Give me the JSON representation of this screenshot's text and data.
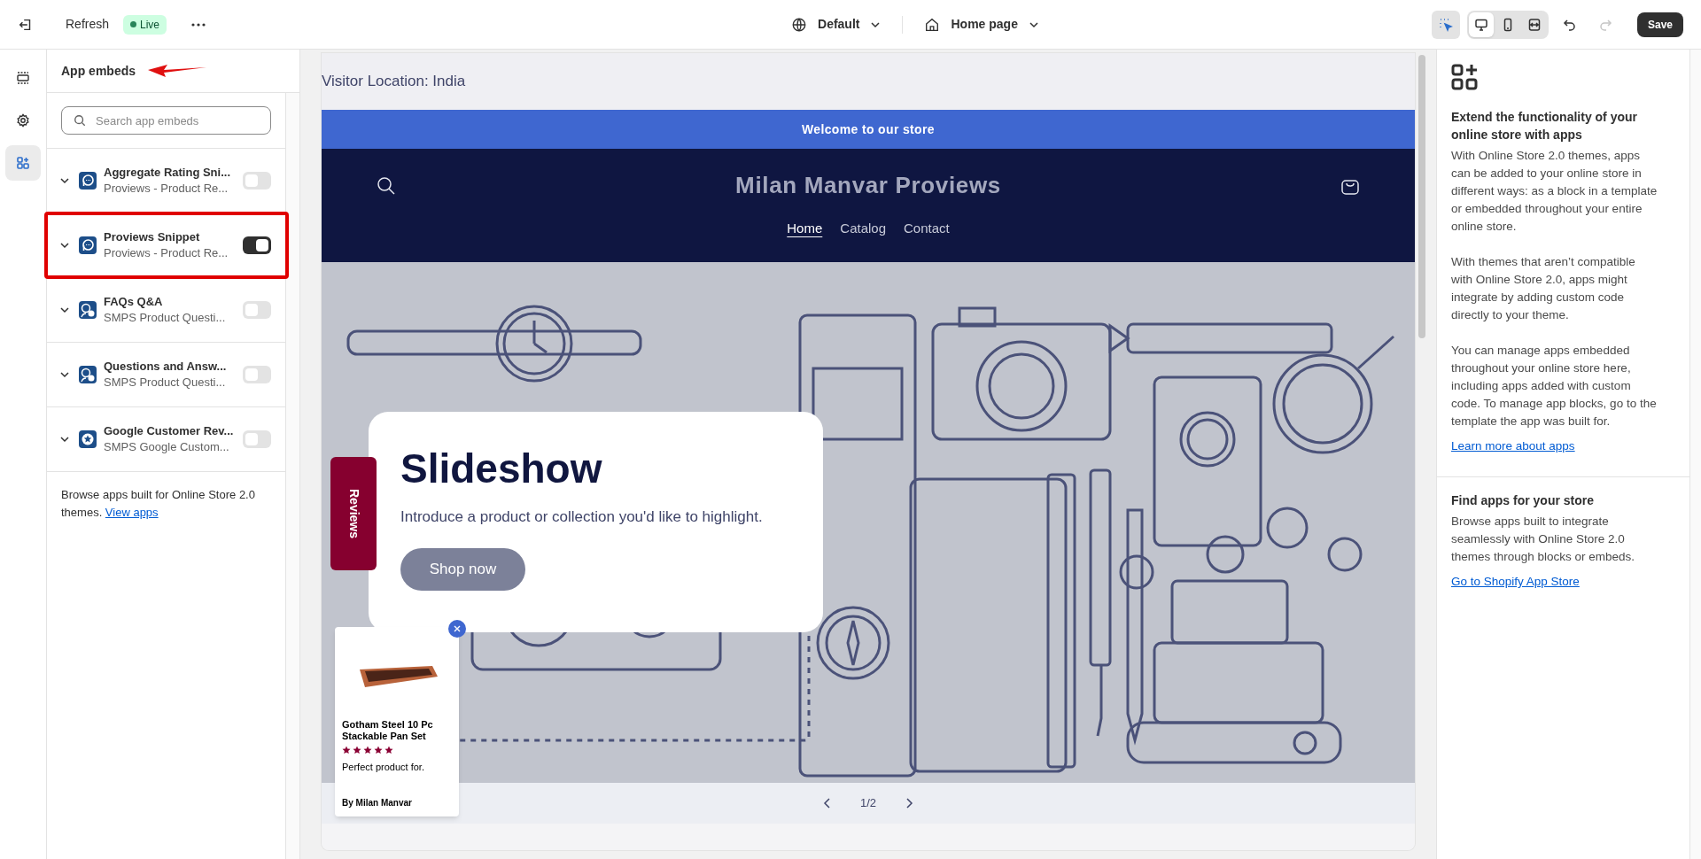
{
  "top_bar": {
    "refresh": "Refresh",
    "status_badge": "Live",
    "theme": "Default",
    "page": "Home page",
    "inspector": {
      "selected": true
    },
    "view_modes": [
      {
        "kind": "desktop",
        "selected": true
      },
      {
        "kind": "mobile",
        "selected": false
      },
      {
        "kind": "fullwidth",
        "selected": false
      }
    ],
    "undo": {
      "disabled": false
    },
    "redo": {
      "disabled": true
    },
    "save": "Save"
  },
  "rail": [
    {
      "kind": "sections",
      "selected": false
    },
    {
      "kind": "settings",
      "selected": false
    },
    {
      "kind": "apps",
      "selected": true
    }
  ],
  "panel": {
    "title": "App embeds",
    "search": {
      "placeholder": "Search app embeds"
    },
    "embeds": [
      {
        "title": "Aggregate Rating Sni...",
        "subtitle": "Proviews - Product Re...",
        "kind": "chat",
        "on": false,
        "highlighted": false
      },
      {
        "title": "Proviews Snippet",
        "subtitle": "Proviews - Product Re...",
        "kind": "chat",
        "on": true,
        "highlighted": true
      },
      {
        "title": "FAQs Q&A",
        "subtitle": "SMPS Product Questi...",
        "kind": "qa",
        "on": false,
        "highlighted": false
      },
      {
        "title": "Questions and Answ...",
        "subtitle": "SMPS Product Questi...",
        "kind": "qa",
        "on": false,
        "highlighted": false
      },
      {
        "title": "Google Customer Rev...",
        "subtitle": "SMPS Google Custom...",
        "kind": "star",
        "on": false,
        "highlighted": false
      }
    ],
    "footer": {
      "text": "Browse apps built for Online Store 2.0 themes.",
      "link": "View apps"
    }
  },
  "preview": {
    "visitor_location": "Visitor Location: India",
    "announcement": "Welcome to our store",
    "store_name": "Milan Manvar Proviews",
    "nav": [
      {
        "label": "Home",
        "selected": true
      },
      {
        "label": "Catalog",
        "selected": false
      },
      {
        "label": "Contact",
        "selected": false
      }
    ],
    "hero": {
      "title": "Slideshow",
      "text": "Introduce a product or collection you'd like to highlight.",
      "button": "Shop now"
    },
    "reviews_tab": "Reviews",
    "review_popup": {
      "product": "Gotham Steel 10 Pc Stackable Pan Set",
      "stars": 5,
      "text": "Perfect product for.",
      "author": "By Milan Manvar"
    },
    "slider": {
      "counter": "1/2"
    }
  },
  "info": {
    "heading": "Extend the functionality of your online store with apps",
    "paragraphs": [
      "With Online Store 2.0 themes, apps can be added to your online store in different ways: as a block in a template or embedded throughout your entire online store.",
      "With themes that aren’t compatible with Online Store 2.0, apps might integrate by adding custom code directly to your theme.",
      "You can manage apps embedded throughout your online store here, including apps added with custom code. To manage app blocks, go to the template the app was built for."
    ],
    "link": "Learn more about apps",
    "find": {
      "heading": "Find apps for your store",
      "text": "Browse apps built to integrate seamlessly with Online Store 2.0 themes through blocks or embeds.",
      "link": "Go to Shopify App Store"
    }
  }
}
